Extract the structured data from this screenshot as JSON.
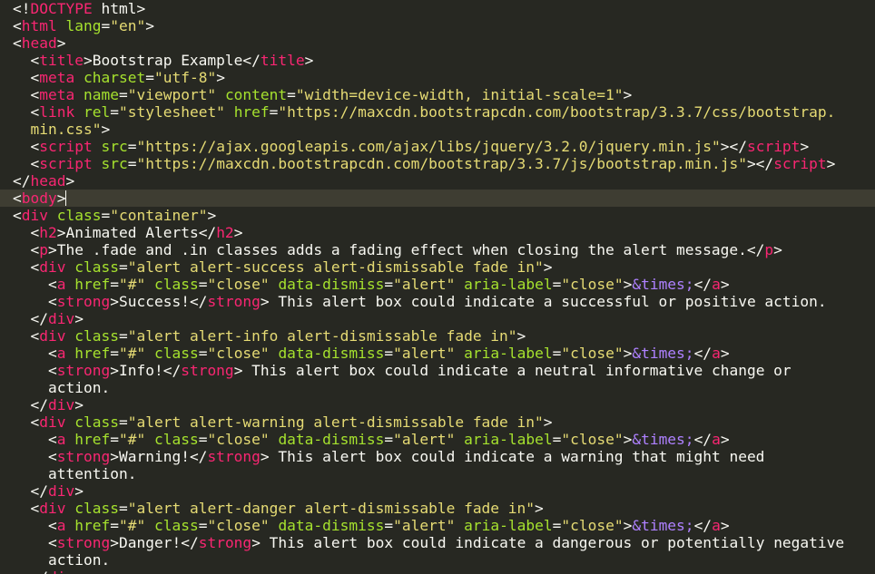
{
  "editor": {
    "theme_colors": {
      "background": "#272822",
      "active_line": "#3e3d32",
      "text": "#f8f8f2",
      "tag": "#f92672",
      "attribute": "#a6e22e",
      "string": "#e6db74",
      "entity": "#ae81ff"
    },
    "cursor_line": 11,
    "lines": [
      [
        [
          "p",
          "<!"
        ],
        [
          "tag",
          "DOCTYPE"
        ],
        [
          "t",
          " html"
        ],
        [
          "p",
          ">"
        ]
      ],
      [
        [
          "p",
          "<"
        ],
        [
          "tag",
          "html"
        ],
        [
          "t",
          " "
        ],
        [
          "attr",
          "lang"
        ],
        [
          "p",
          "="
        ],
        [
          "str",
          "\"en\""
        ],
        [
          "p",
          ">"
        ]
      ],
      [
        [
          "p",
          "<"
        ],
        [
          "tag",
          "head"
        ],
        [
          "p",
          ">"
        ]
      ],
      [
        [
          "t",
          "  "
        ],
        [
          "p",
          "<"
        ],
        [
          "tag",
          "title"
        ],
        [
          "p",
          ">"
        ],
        [
          "t",
          "Bootstrap Example"
        ],
        [
          "p",
          "</"
        ],
        [
          "tag",
          "title"
        ],
        [
          "p",
          ">"
        ]
      ],
      [
        [
          "t",
          "  "
        ],
        [
          "p",
          "<"
        ],
        [
          "tag",
          "meta"
        ],
        [
          "t",
          " "
        ],
        [
          "attr",
          "charset"
        ],
        [
          "p",
          "="
        ],
        [
          "str",
          "\"utf-8\""
        ],
        [
          "p",
          ">"
        ]
      ],
      [
        [
          "t",
          "  "
        ],
        [
          "p",
          "<"
        ],
        [
          "tag",
          "meta"
        ],
        [
          "t",
          " "
        ],
        [
          "attr",
          "name"
        ],
        [
          "p",
          "="
        ],
        [
          "str",
          "\"viewport\""
        ],
        [
          "t",
          " "
        ],
        [
          "attr",
          "content"
        ],
        [
          "p",
          "="
        ],
        [
          "str",
          "\"width=device-width, initial-scale=1\""
        ],
        [
          "p",
          ">"
        ]
      ],
      [
        [
          "t",
          "  "
        ],
        [
          "p",
          "<"
        ],
        [
          "tag",
          "link"
        ],
        [
          "t",
          " "
        ],
        [
          "attr",
          "rel"
        ],
        [
          "p",
          "="
        ],
        [
          "str",
          "\"stylesheet\""
        ],
        [
          "t",
          " "
        ],
        [
          "attr",
          "href"
        ],
        [
          "p",
          "="
        ],
        [
          "str",
          "\"https://maxcdn.bootstrapcdn.com/bootstrap/3.3.7/css/bootstrap."
        ]
      ],
      [
        [
          "str",
          "  min.css\""
        ],
        [
          "p",
          ">"
        ]
      ],
      [
        [
          "t",
          "  "
        ],
        [
          "p",
          "<"
        ],
        [
          "tag",
          "script"
        ],
        [
          "t",
          " "
        ],
        [
          "attr",
          "src"
        ],
        [
          "p",
          "="
        ],
        [
          "str",
          "\"https://ajax.googleapis.com/ajax/libs/jquery/3.2.0/jquery.min.js\""
        ],
        [
          "p",
          "></"
        ],
        [
          "tag",
          "script"
        ],
        [
          "p",
          ">"
        ]
      ],
      [
        [
          "t",
          "  "
        ],
        [
          "p",
          "<"
        ],
        [
          "tag",
          "script"
        ],
        [
          "t",
          " "
        ],
        [
          "attr",
          "src"
        ],
        [
          "p",
          "="
        ],
        [
          "str",
          "\"https://maxcdn.bootstrapcdn.com/bootstrap/3.3.7/js/bootstrap.min.js\""
        ],
        [
          "p",
          "></"
        ],
        [
          "tag",
          "script"
        ],
        [
          "p",
          ">"
        ]
      ],
      [
        [
          "p",
          "</"
        ],
        [
          "tag",
          "head"
        ],
        [
          "p",
          ">"
        ]
      ],
      [
        [
          "p",
          "<"
        ],
        [
          "tag",
          "body"
        ],
        [
          "p",
          ">"
        ]
      ],
      [
        [
          "p",
          "<"
        ],
        [
          "tag",
          "div"
        ],
        [
          "t",
          " "
        ],
        [
          "attr",
          "class"
        ],
        [
          "p",
          "="
        ],
        [
          "str",
          "\"container\""
        ],
        [
          "p",
          ">"
        ]
      ],
      [
        [
          "t",
          "  "
        ],
        [
          "p",
          "<"
        ],
        [
          "tag",
          "h2"
        ],
        [
          "p",
          ">"
        ],
        [
          "t",
          "Animated Alerts"
        ],
        [
          "p",
          "</"
        ],
        [
          "tag",
          "h2"
        ],
        [
          "p",
          ">"
        ]
      ],
      [
        [
          "t",
          "  "
        ],
        [
          "p",
          "<"
        ],
        [
          "tag",
          "p"
        ],
        [
          "p",
          ">"
        ],
        [
          "t",
          "The .fade and .in classes adds a fading effect when closing the alert message."
        ],
        [
          "p",
          "</"
        ],
        [
          "tag",
          "p"
        ],
        [
          "p",
          ">"
        ]
      ],
      [
        [
          "t",
          "  "
        ],
        [
          "p",
          "<"
        ],
        [
          "tag",
          "div"
        ],
        [
          "t",
          " "
        ],
        [
          "attr",
          "class"
        ],
        [
          "p",
          "="
        ],
        [
          "str",
          "\"alert alert-success alert-dismissable fade in\""
        ],
        [
          "p",
          ">"
        ]
      ],
      [
        [
          "t",
          "    "
        ],
        [
          "p",
          "<"
        ],
        [
          "tag",
          "a"
        ],
        [
          "t",
          " "
        ],
        [
          "attr",
          "href"
        ],
        [
          "p",
          "="
        ],
        [
          "str",
          "\"#\""
        ],
        [
          "t",
          " "
        ],
        [
          "attr",
          "class"
        ],
        [
          "p",
          "="
        ],
        [
          "str",
          "\"close\""
        ],
        [
          "t",
          " "
        ],
        [
          "attr",
          "data-dismiss"
        ],
        [
          "p",
          "="
        ],
        [
          "str",
          "\"alert\""
        ],
        [
          "t",
          " "
        ],
        [
          "attr",
          "aria-label"
        ],
        [
          "p",
          "="
        ],
        [
          "str",
          "\"close\""
        ],
        [
          "p",
          ">"
        ],
        [
          "ent",
          "&times;"
        ],
        [
          "p",
          "</"
        ],
        [
          "tag",
          "a"
        ],
        [
          "p",
          ">"
        ]
      ],
      [
        [
          "t",
          "    "
        ],
        [
          "p",
          "<"
        ],
        [
          "tag",
          "strong"
        ],
        [
          "p",
          ">"
        ],
        [
          "t",
          "Success!"
        ],
        [
          "p",
          "</"
        ],
        [
          "tag",
          "strong"
        ],
        [
          "p",
          ">"
        ],
        [
          "t",
          " This alert box could indicate a successful or positive action."
        ]
      ],
      [
        [
          "t",
          "  "
        ],
        [
          "p",
          "</"
        ],
        [
          "tag",
          "div"
        ],
        [
          "p",
          ">"
        ]
      ],
      [
        [
          "t",
          "  "
        ],
        [
          "p",
          "<"
        ],
        [
          "tag",
          "div"
        ],
        [
          "t",
          " "
        ],
        [
          "attr",
          "class"
        ],
        [
          "p",
          "="
        ],
        [
          "str",
          "\"alert alert-info alert-dismissable fade in\""
        ],
        [
          "p",
          ">"
        ]
      ],
      [
        [
          "t",
          "    "
        ],
        [
          "p",
          "<"
        ],
        [
          "tag",
          "a"
        ],
        [
          "t",
          " "
        ],
        [
          "attr",
          "href"
        ],
        [
          "p",
          "="
        ],
        [
          "str",
          "\"#\""
        ],
        [
          "t",
          " "
        ],
        [
          "attr",
          "class"
        ],
        [
          "p",
          "="
        ],
        [
          "str",
          "\"close\""
        ],
        [
          "t",
          " "
        ],
        [
          "attr",
          "data-dismiss"
        ],
        [
          "p",
          "="
        ],
        [
          "str",
          "\"alert\""
        ],
        [
          "t",
          " "
        ],
        [
          "attr",
          "aria-label"
        ],
        [
          "p",
          "="
        ],
        [
          "str",
          "\"close\""
        ],
        [
          "p",
          ">"
        ],
        [
          "ent",
          "&times;"
        ],
        [
          "p",
          "</"
        ],
        [
          "tag",
          "a"
        ],
        [
          "p",
          ">"
        ]
      ],
      [
        [
          "t",
          "    "
        ],
        [
          "p",
          "<"
        ],
        [
          "tag",
          "strong"
        ],
        [
          "p",
          ">"
        ],
        [
          "t",
          "Info!"
        ],
        [
          "p",
          "</"
        ],
        [
          "tag",
          "strong"
        ],
        [
          "p",
          ">"
        ],
        [
          "t",
          " This alert box could indicate a neutral informative change or"
        ]
      ],
      [
        [
          "t",
          "    action."
        ]
      ],
      [
        [
          "t",
          "  "
        ],
        [
          "p",
          "</"
        ],
        [
          "tag",
          "div"
        ],
        [
          "p",
          ">"
        ]
      ],
      [
        [
          "t",
          "  "
        ],
        [
          "p",
          "<"
        ],
        [
          "tag",
          "div"
        ],
        [
          "t",
          " "
        ],
        [
          "attr",
          "class"
        ],
        [
          "p",
          "="
        ],
        [
          "str",
          "\"alert alert-warning alert-dismissable fade in\""
        ],
        [
          "p",
          ">"
        ]
      ],
      [
        [
          "t",
          "    "
        ],
        [
          "p",
          "<"
        ],
        [
          "tag",
          "a"
        ],
        [
          "t",
          " "
        ],
        [
          "attr",
          "href"
        ],
        [
          "p",
          "="
        ],
        [
          "str",
          "\"#\""
        ],
        [
          "t",
          " "
        ],
        [
          "attr",
          "class"
        ],
        [
          "p",
          "="
        ],
        [
          "str",
          "\"close\""
        ],
        [
          "t",
          " "
        ],
        [
          "attr",
          "data-dismiss"
        ],
        [
          "p",
          "="
        ],
        [
          "str",
          "\"alert\""
        ],
        [
          "t",
          " "
        ],
        [
          "attr",
          "aria-label"
        ],
        [
          "p",
          "="
        ],
        [
          "str",
          "\"close\""
        ],
        [
          "p",
          ">"
        ],
        [
          "ent",
          "&times;"
        ],
        [
          "p",
          "</"
        ],
        [
          "tag",
          "a"
        ],
        [
          "p",
          ">"
        ]
      ],
      [
        [
          "t",
          "    "
        ],
        [
          "p",
          "<"
        ],
        [
          "tag",
          "strong"
        ],
        [
          "p",
          ">"
        ],
        [
          "t",
          "Warning!"
        ],
        [
          "p",
          "</"
        ],
        [
          "tag",
          "strong"
        ],
        [
          "p",
          ">"
        ],
        [
          "t",
          " This alert box could indicate a warning that might need"
        ]
      ],
      [
        [
          "t",
          "    attention."
        ]
      ],
      [
        [
          "t",
          "  "
        ],
        [
          "p",
          "</"
        ],
        [
          "tag",
          "div"
        ],
        [
          "p",
          ">"
        ]
      ],
      [
        [
          "t",
          "  "
        ],
        [
          "p",
          "<"
        ],
        [
          "tag",
          "div"
        ],
        [
          "t",
          " "
        ],
        [
          "attr",
          "class"
        ],
        [
          "p",
          "="
        ],
        [
          "str",
          "\"alert alert-danger alert-dismissable fade in\""
        ],
        [
          "p",
          ">"
        ]
      ],
      [
        [
          "t",
          "    "
        ],
        [
          "p",
          "<"
        ],
        [
          "tag",
          "a"
        ],
        [
          "t",
          " "
        ],
        [
          "attr",
          "href"
        ],
        [
          "p",
          "="
        ],
        [
          "str",
          "\"#\""
        ],
        [
          "t",
          " "
        ],
        [
          "attr",
          "class"
        ],
        [
          "p",
          "="
        ],
        [
          "str",
          "\"close\""
        ],
        [
          "t",
          " "
        ],
        [
          "attr",
          "data-dismiss"
        ],
        [
          "p",
          "="
        ],
        [
          "str",
          "\"alert\""
        ],
        [
          "t",
          " "
        ],
        [
          "attr",
          "aria-label"
        ],
        [
          "p",
          "="
        ],
        [
          "str",
          "\"close\""
        ],
        [
          "p",
          ">"
        ],
        [
          "ent",
          "&times;"
        ],
        [
          "p",
          "</"
        ],
        [
          "tag",
          "a"
        ],
        [
          "p",
          ">"
        ]
      ],
      [
        [
          "t",
          "    "
        ],
        [
          "p",
          "<"
        ],
        [
          "tag",
          "strong"
        ],
        [
          "p",
          ">"
        ],
        [
          "t",
          "Danger!"
        ],
        [
          "p",
          "</"
        ],
        [
          "tag",
          "strong"
        ],
        [
          "p",
          ">"
        ],
        [
          "t",
          " This alert box could indicate a dangerous or potentially negative"
        ]
      ],
      [
        [
          "t",
          "    action."
        ]
      ],
      [
        [
          "t",
          "  "
        ],
        [
          "p",
          "</"
        ],
        [
          "tag",
          "div"
        ],
        [
          "p",
          ">"
        ]
      ]
    ]
  }
}
